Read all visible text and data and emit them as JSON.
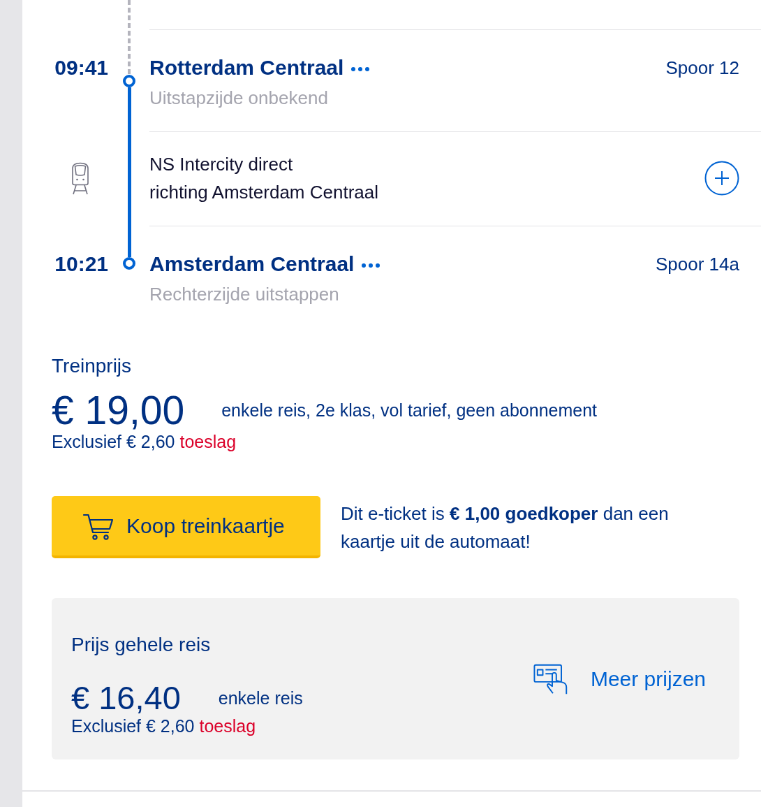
{
  "timeline": {
    "legs": [
      {
        "kind": "walk"
      },
      {
        "kind": "stop",
        "time": "09:41",
        "station": "Rotterdam Centraal",
        "platform": "Spoor 12",
        "note": "Uitstapzijde onbekend"
      },
      {
        "kind": "ride",
        "train": "NS Intercity direct",
        "direction": "richting Amsterdam Centraal",
        "expanded": false
      },
      {
        "kind": "stop",
        "time": "10:21",
        "station": "Amsterdam Centraal",
        "platform": "Spoor 14a",
        "note": "Rechterzijde uitstappen"
      }
    ]
  },
  "train_price": {
    "title": "Treinprijs",
    "price": "€ 19,00",
    "description": "enkele reis, 2e klas, vol tarief, geen abonnement",
    "surcharge": "Exclusief € 2,60",
    "surcharge_link": "toeslag"
  },
  "purchase": {
    "button": "Koop treinkaartje",
    "promo": "Dit e-ticket is **€ 1,00 goedkoper** dan een kaartje uit de automaat!"
  },
  "journey_price": {
    "title": "Prijs gehele reis",
    "price": "€ 16,40",
    "description": "enkele reis",
    "surcharge": "Exclusief € 2,60",
    "surcharge_link": "toeslag",
    "more_link": "Meer prijzen"
  }
}
